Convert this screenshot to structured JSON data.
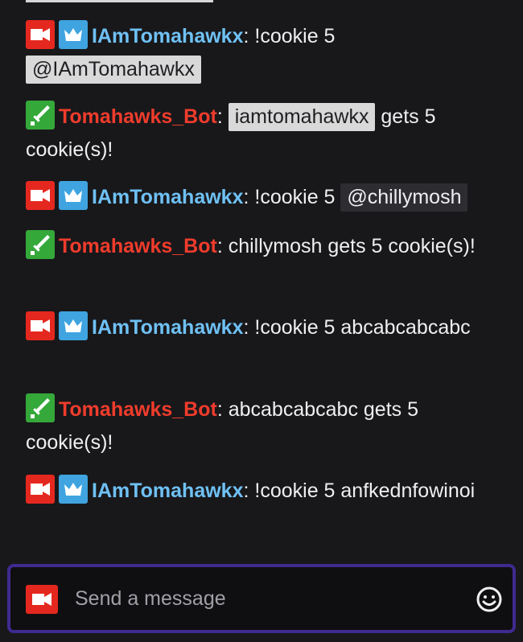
{
  "colors": {
    "background": "#18181b",
    "username_broadcaster": "#6fc1f4",
    "username_bot": "#f03c2c",
    "badge_broadcaster": "#e5281f",
    "badge_crown": "#3fa4e0",
    "badge_sword": "#35a83a",
    "input_border": "#3f2a8f"
  },
  "messages": [
    {
      "user": "IAmTomahawkx",
      "separator": ":",
      "text": " !cookie 5",
      "mention": "@IAmTomahawkx",
      "after": ""
    },
    {
      "user": "Tomahawks_Bot",
      "separator": ":",
      "text": " ",
      "mention": "iamtomahawkx",
      "after": " gets 5 cookie(s)!"
    },
    {
      "user": "IAmTomahawkx",
      "separator": ":",
      "text": " !cookie 5 ",
      "mention": "@chillymosh",
      "after": ""
    },
    {
      "user": "Tomahawks_Bot",
      "separator": ":",
      "text": " chillymosh gets 5 cookie(s)!"
    },
    {
      "user": "IAmTomahawkx",
      "separator": ":",
      "text": " !cookie 5 abcabcabcabc"
    },
    {
      "user": "Tomahawks_Bot",
      "separator": ":",
      "text": " abcabcabcabc gets 5 cookie(s)!"
    },
    {
      "user": "IAmTomahawkx",
      "separator": ":",
      "text": " !cookie 5 anfkednfowinoi"
    }
  ],
  "input": {
    "placeholder": "Send a message",
    "value": ""
  },
  "icons": {
    "broadcaster": "video-camera-icon",
    "crown": "crown-icon",
    "sword": "sword-icon",
    "emote": "smiley-face-icon"
  }
}
